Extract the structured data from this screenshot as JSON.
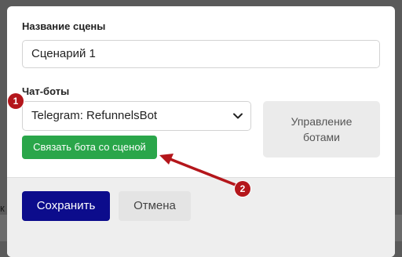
{
  "background": {
    "partial_text": "к"
  },
  "modal": {
    "scene_name_label": "Название сцены",
    "scene_name_value": "Сценарий 1",
    "chatbots_label": "Чат-боты",
    "bot_select_value": "Telegram: RefunnelsBot",
    "manage_bots_button": "Управление ботами",
    "link_bot_button": "Связать бота со сценой",
    "save_button": "Сохранить",
    "cancel_button": "Отмена"
  },
  "annotations": {
    "step1": "1",
    "step2": "2"
  },
  "colors": {
    "save_button": "#0c0c8c",
    "link_button": "#2aa64a",
    "annotation_red": "#b4161b"
  }
}
